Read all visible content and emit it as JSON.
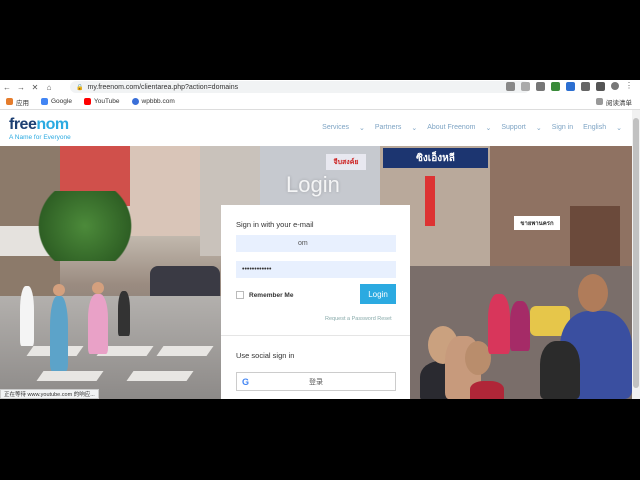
{
  "browser": {
    "url": "my.freenom.com/clientarea.php?action=domains",
    "bookmarks": [
      {
        "label": "应用",
        "color": "#e57c2c"
      },
      {
        "label": "Google",
        "color": "#4285f4"
      },
      {
        "label": "YouTube",
        "color": "#ff0000"
      },
      {
        "label": "wpbbb.com",
        "color": "#3a6fd8"
      }
    ],
    "reading_list": "阅读清单",
    "status_text": "正在等待 www.youtube.com 的响应..."
  },
  "site": {
    "logo_text_a": "free",
    "logo_text_b": "nom",
    "tagline": "A Name for Everyone",
    "nav": [
      "Services",
      "Partners",
      "About Freenom",
      "Support",
      "Sign in",
      "English"
    ],
    "hero_heading": "Login",
    "signs": [
      "ซิงเอ็งหลี",
      "จีบสงค์ย",
      "ขายพานครก"
    ]
  },
  "login": {
    "title": "Sign in with your e-mail",
    "email_value": "om",
    "password_value": "••••••••••••",
    "remember_label": "Remember Me",
    "login_button": "Login",
    "reset_link": "Request a Password Reset",
    "social_title": "Use social sign in",
    "google_button": "登录"
  }
}
